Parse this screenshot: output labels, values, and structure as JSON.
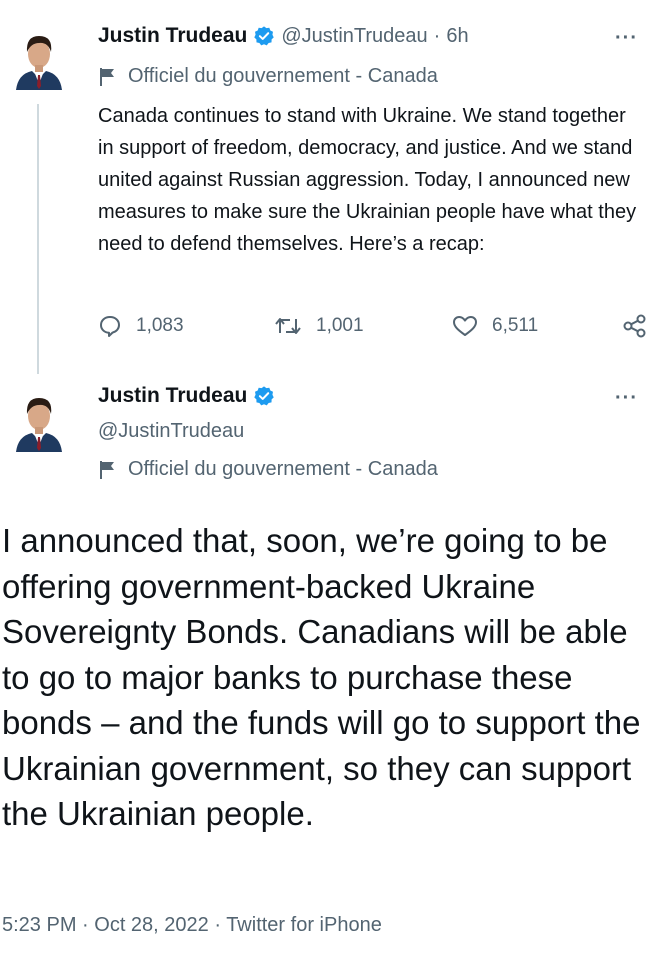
{
  "tweet1": {
    "author_name": "Justin Trudeau",
    "handle": "@JustinTrudeau",
    "separator": "·",
    "time": "6h",
    "more": "···",
    "gov_label": "Officiel du gouvernement - Canada",
    "text": "Canada continues to stand with Ukraine. We stand together in support of freedom, democracy, and justice. And we stand united against Russian aggression. Today, I announced new measures to make sure the Ukrainian people have what they need to defend themselves. Here’s a recap:",
    "replies": "1,083",
    "retweets": "1,001",
    "likes": "6,511"
  },
  "tweet2": {
    "author_name": "Justin Trudeau",
    "handle": "@JustinTrudeau",
    "more": "···",
    "gov_label": "Officiel du gouvernement - Canada",
    "text": "I announced that, soon, we’re going to be offering government-backed Ukraine Sovereignty Bonds. Canadians will be able to go to major banks to purchase these bonds – and the funds will go to support the Ukrainian government, so they can support the Ukrainian people.",
    "timestamp": "5:23 PM · Oct 28, 2022 · Twitter for iPhone"
  },
  "colors": {
    "verified_blue": "#1d9bf0",
    "secondary_text": "#536471",
    "primary_text": "#0f1419"
  },
  "icons": {
    "verified": "verified-badge-icon",
    "flag": "flag-icon",
    "reply": "reply-icon",
    "retweet": "retweet-icon",
    "like": "heart-icon",
    "share": "share-icon",
    "more": "more-icon"
  }
}
